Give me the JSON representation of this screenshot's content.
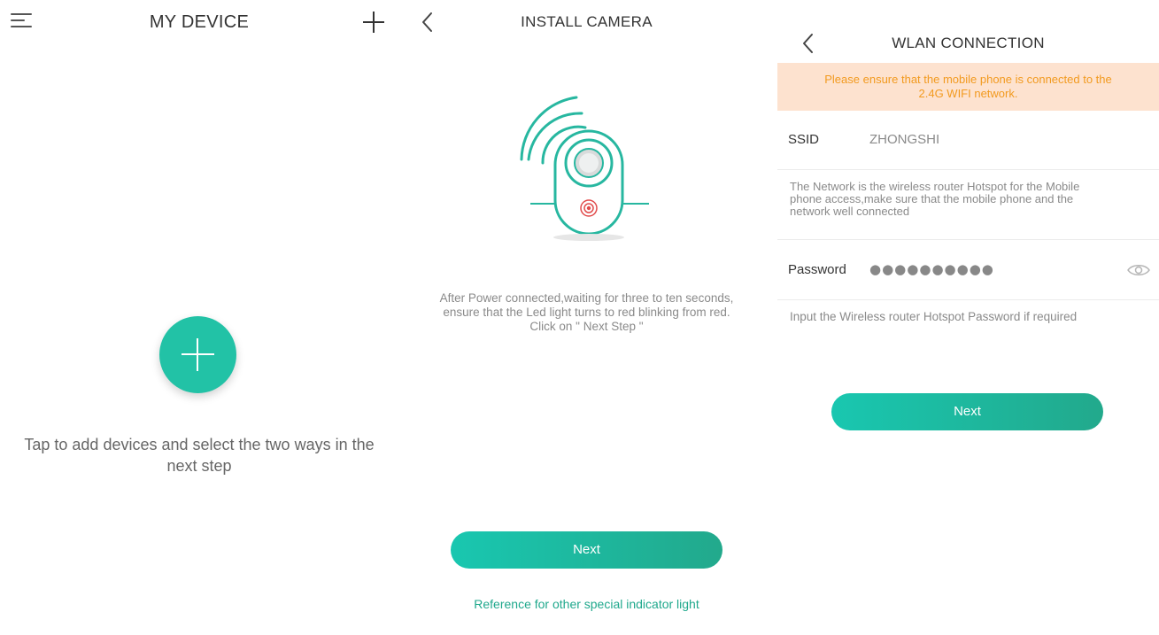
{
  "my_device": {
    "title": "MY DEVICE",
    "menu_icon": "hamburger-menu-icon",
    "add_icon": "plus-icon",
    "fab_icon": "plus-icon",
    "hint": "Tap to add devices and select the two ways in the next step"
  },
  "install_camera": {
    "title": "INSTALL CAMERA",
    "back_icon": "chevron-left-icon",
    "illustration": "camera-wifi-illustration",
    "description_lines": [
      "After Power connected,waiting for three to ten seconds,",
      "ensure that the Led light turns to red blinking from red.",
      "Click on \" Next Step \""
    ],
    "next_label": "Next",
    "reference_link": "Reference for other special indicator light"
  },
  "wlan_connection": {
    "title": "WLAN CONNECTION",
    "back_icon": "chevron-left-icon",
    "warning_lines": [
      "Please ensure that the mobile phone is connected to the",
      "2.4G WIFI network."
    ],
    "ssid_label": "SSID",
    "ssid_value": "ZHONGSHI",
    "network_desc_lines": [
      "The Network is the wireless router Hotspot for the Mobile",
      "phone access,make sure that the mobile phone and the",
      "network well connected"
    ],
    "password_label": "Password",
    "password_value": "●●●●●●●●●●",
    "password_toggle_icon": "eye-icon",
    "password_hint": "Input the Wireless router Hotspot Password if required",
    "next_label": "Next"
  },
  "colors": {
    "accent": "#22c2a6",
    "link": "#1fa88c",
    "warning_bg": "#fde2cf",
    "warning_text": "#f29a1f"
  }
}
